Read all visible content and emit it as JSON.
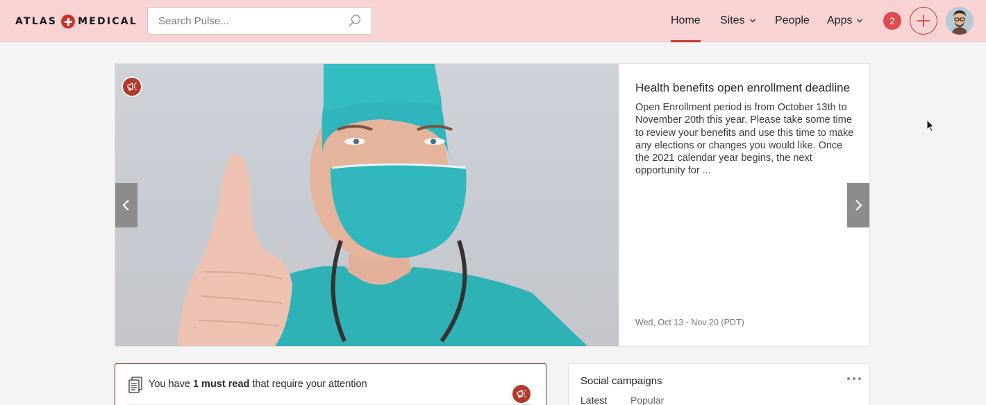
{
  "header": {
    "logo_left": "ATLAS",
    "logo_right": "MEDICAL",
    "search_placeholder": "Search Pulse...",
    "nav": [
      {
        "label": "Home",
        "active": true,
        "dropdown": false
      },
      {
        "label": "Sites",
        "active": false,
        "dropdown": true
      },
      {
        "label": "People",
        "active": false,
        "dropdown": false
      },
      {
        "label": "Apps",
        "active": false,
        "dropdown": true
      }
    ],
    "notification_count": "2",
    "accent_color": "#c8342c",
    "header_bg": "#f8d3d4"
  },
  "hero": {
    "title": "Health benefits open enrollment deadline",
    "body": "Open Enrollment period is from October 13th to November 20th this year. Please take some time to review your benefits and use this time to make any elections or changes you would like. Once the 2021 calendar year begins, the next opportunity for ...",
    "date": "Wed, Oct 13 - Nov 20 (PDT)",
    "badge_icon": "megaphone-icon"
  },
  "must_read": {
    "prefix": "You have ",
    "count_text": "1 must read",
    "suffix": " that require your attention"
  },
  "social": {
    "title": "Social campaigns",
    "tabs": [
      "Latest",
      "Popular"
    ]
  }
}
